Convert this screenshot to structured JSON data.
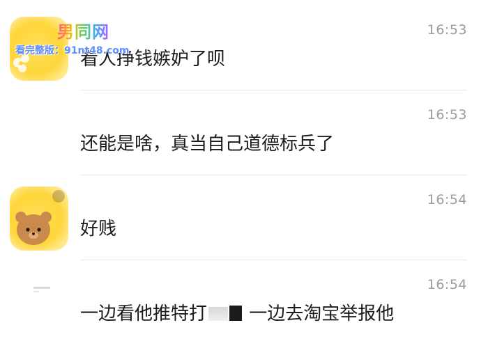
{
  "watermark": {
    "title": "男同网",
    "url_text": "看完整版：91nt48.com"
  },
  "messages": [
    {
      "time": "16:53",
      "text": "看人挣钱嫉妒了呗",
      "avatar": "yellow"
    },
    {
      "time": "16:53",
      "text": "还能是啥，真当自己道德标兵了",
      "avatar": "none"
    },
    {
      "time": "16:54",
      "text": "好贱",
      "avatar": "bear"
    },
    {
      "time": "16:54",
      "text_before": "一边看他推特打",
      "text_after": "一边去淘宝举报他",
      "avatar": "faint"
    }
  ],
  "colors": {
    "timestamp": "#9b9b9b",
    "message_text": "#1b1b1b",
    "divider": "#e6e6e6",
    "avatar_yellow": "#ffd53a"
  }
}
